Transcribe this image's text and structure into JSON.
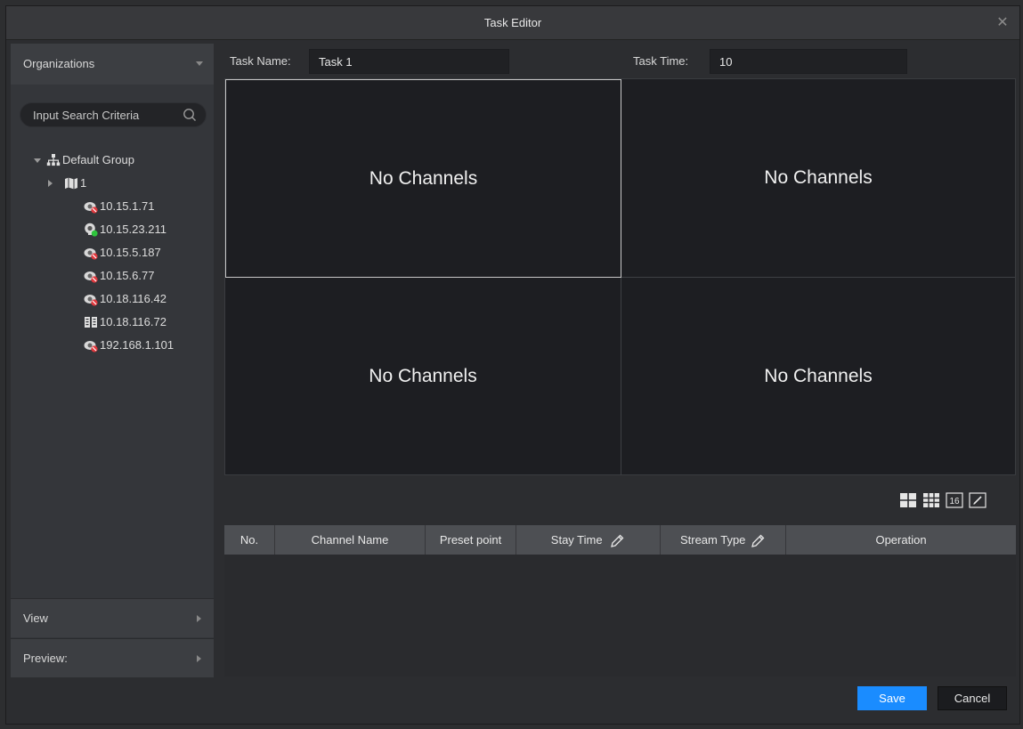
{
  "window": {
    "title": "Task Editor",
    "close_glyph": "✕"
  },
  "sidebar": {
    "header": "Organizations",
    "search_placeholder": "Input Search Criteria",
    "tree": {
      "group": "Default Group",
      "subgroup": "1",
      "devices": [
        {
          "label": "10.15.1.71",
          "icon": "camera-offline-icon"
        },
        {
          "label": "10.15.23.211",
          "icon": "camera-online-icon"
        },
        {
          "label": "10.15.5.187",
          "icon": "camera-offline-icon"
        },
        {
          "label": "10.15.6.77",
          "icon": "camera-offline-icon"
        },
        {
          "label": "10.18.116.42",
          "icon": "camera-offline-icon"
        },
        {
          "label": "10.18.116.72",
          "icon": "encoder-device-icon"
        },
        {
          "label": "192.168.1.101",
          "icon": "camera-offline-icon"
        }
      ]
    },
    "view_label": "View",
    "preview_label": "Preview:"
  },
  "task": {
    "name_label": "Task Name:",
    "name_value": "Task 1",
    "time_label": "Task Time:",
    "time_value": "10"
  },
  "video_grid": {
    "cells": [
      "No Channels",
      "No Channels",
      "No Channels",
      "No Channels"
    ]
  },
  "layout_buttons": [
    "layout-4-icon",
    "layout-9-icon",
    "layout-16-icon",
    "edit-layout-icon"
  ],
  "layout_16_text": "16",
  "table": {
    "columns": [
      "No.",
      "Channel Name",
      "Preset point",
      "Stay Time",
      "Stream Type",
      "Operation"
    ],
    "rows": []
  },
  "footer": {
    "save_label": "Save",
    "cancel_label": "Cancel"
  },
  "colors": {
    "accent": "#1a8cff",
    "offline_badge": "#e0393e",
    "online_badge": "#2ec43c"
  }
}
